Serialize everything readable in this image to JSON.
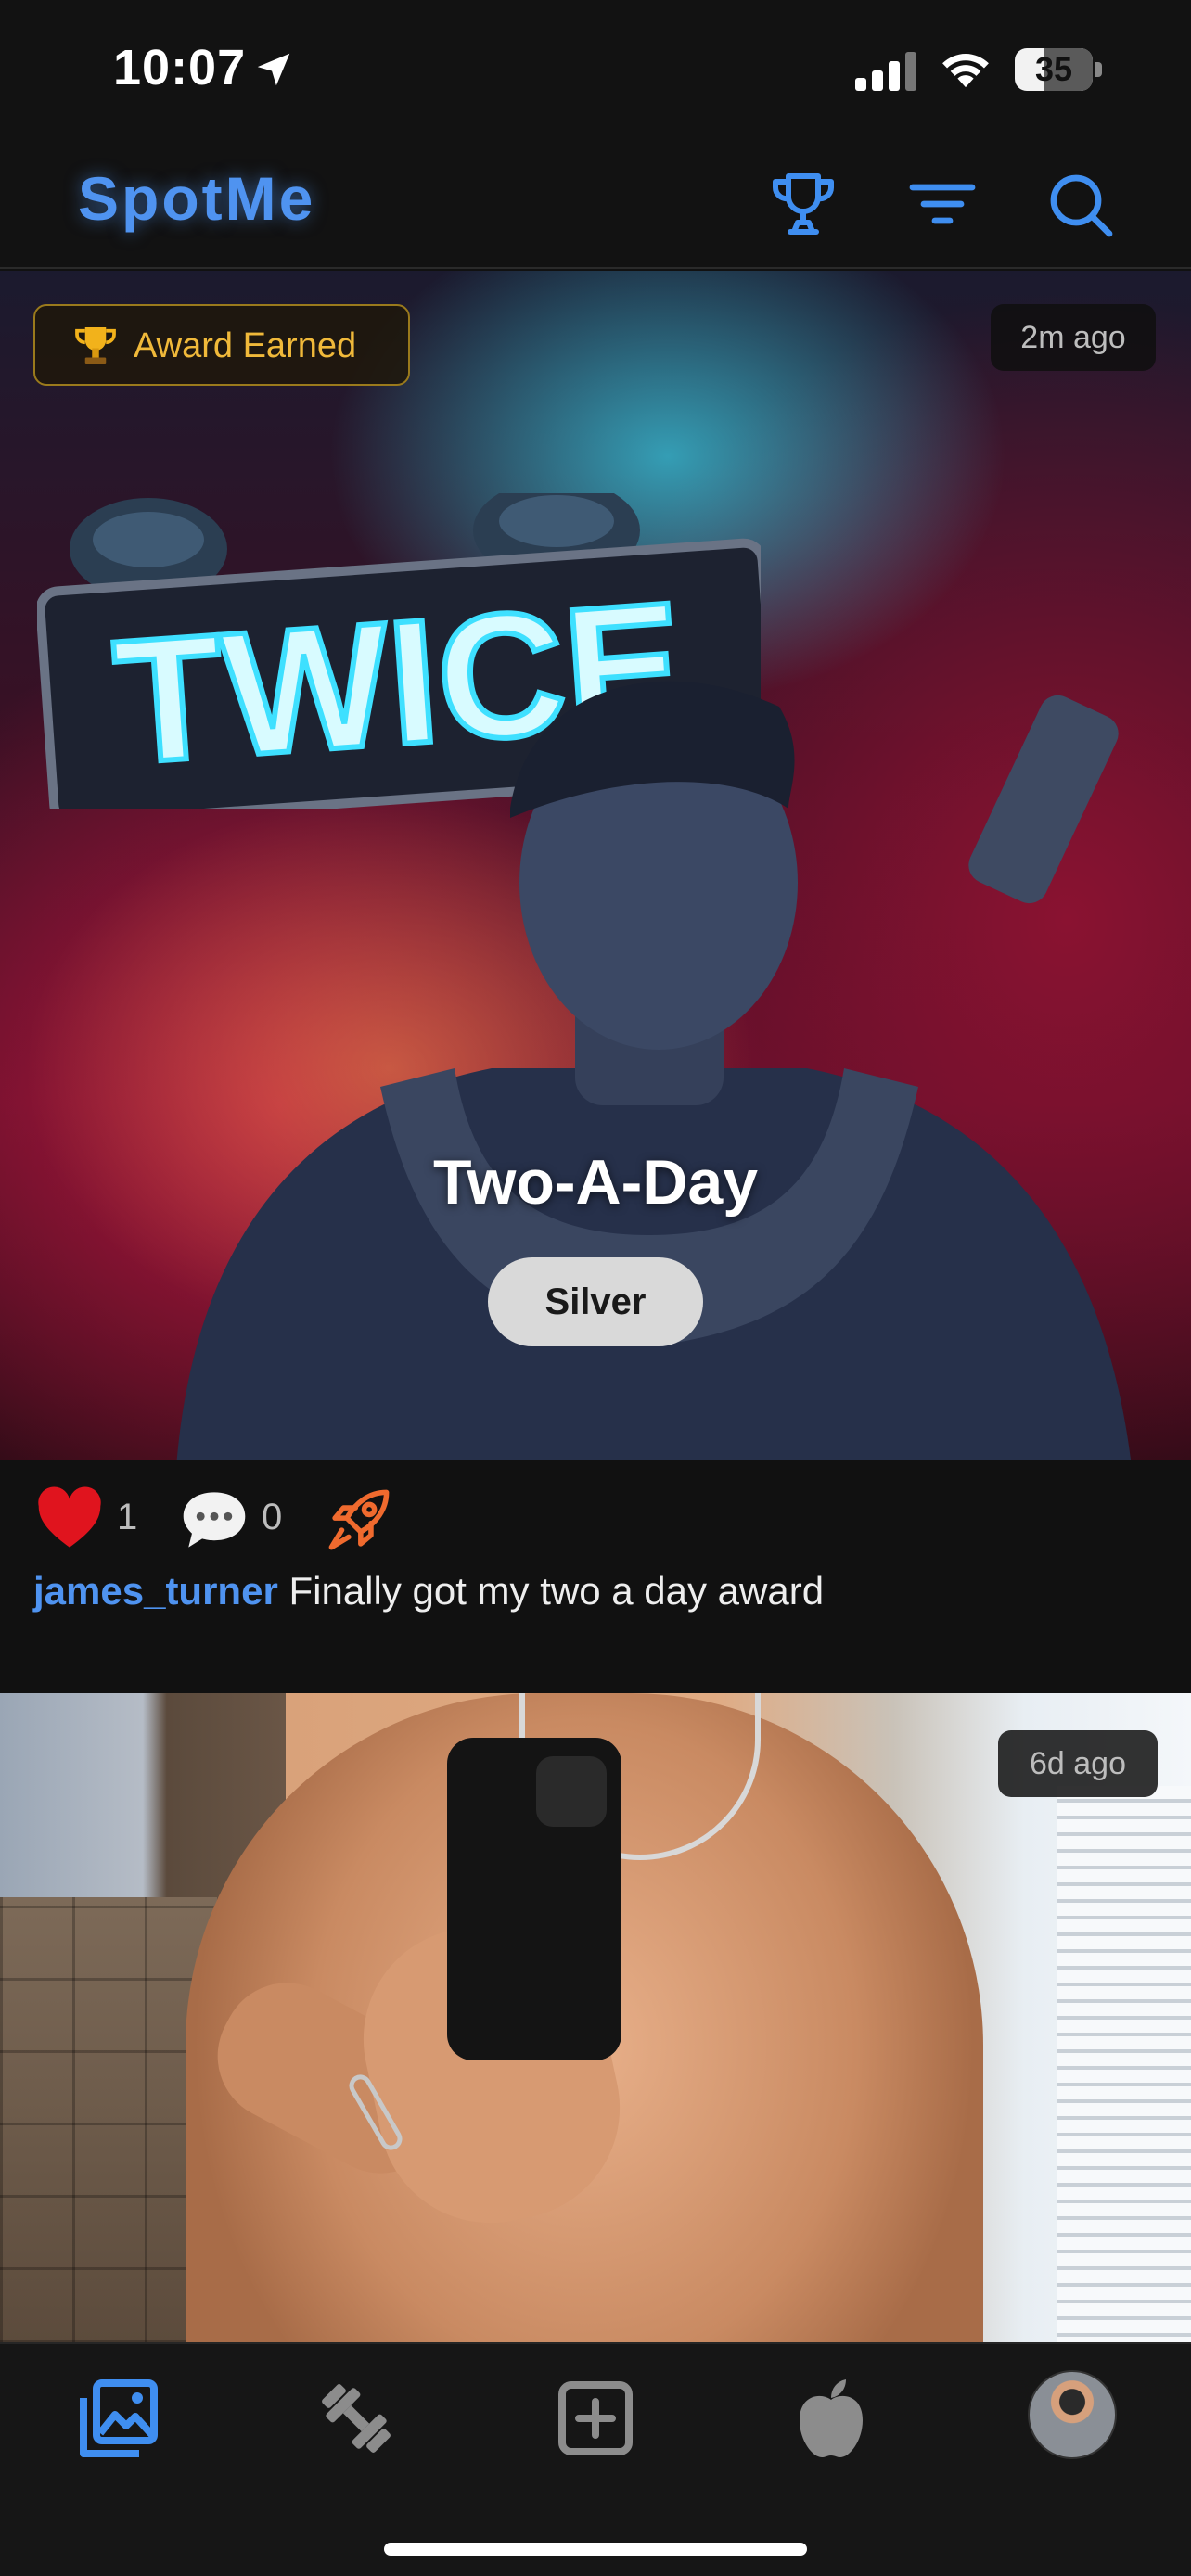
{
  "status_bar": {
    "time": "10:07",
    "battery": "35"
  },
  "header": {
    "brand": "SpotMe",
    "icons": [
      "trophy-icon",
      "filter-icon",
      "search-icon"
    ],
    "accent": "#4f93f0"
  },
  "posts": [
    {
      "badge": "Award Earned",
      "time_ago": "2m ago",
      "award_name": "Two-A-Day",
      "level": "Silver",
      "sign_text": "TWICE",
      "likes": "1",
      "comments": "0",
      "username": "james_turner",
      "caption": "Finally got my two a day award"
    },
    {
      "time_ago": "6d ago"
    }
  ],
  "tab_bar": {
    "items": [
      "gallery-icon",
      "dumbbell-icon",
      "add-post-icon",
      "nutrition-icon",
      "profile-avatar"
    ],
    "active": "gallery-icon"
  }
}
